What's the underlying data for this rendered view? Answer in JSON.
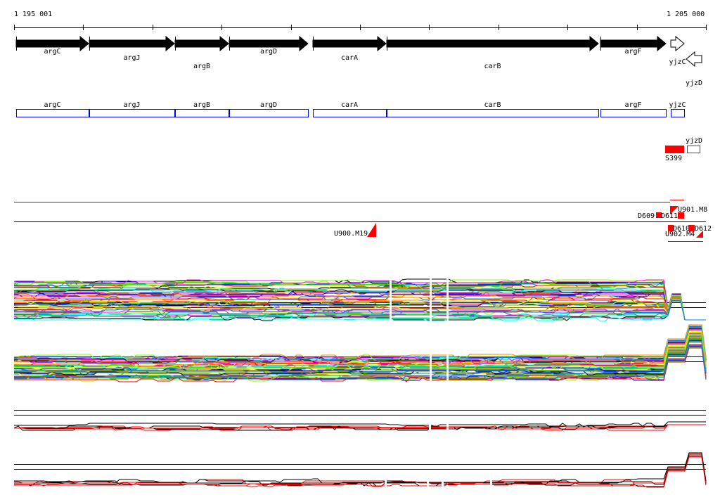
{
  "ruler": {
    "start_label": "1 195 001",
    "end_label": "1 205 000",
    "start": 1195001,
    "end": 1205000
  },
  "genes": [
    {
      "name": "argC",
      "start": 1195031,
      "end": 1196080,
      "strand": "+"
    },
    {
      "name": "argJ",
      "start": 1196091,
      "end": 1197320,
      "strand": "+"
    },
    {
      "name": "argB",
      "start": 1197331,
      "end": 1198100,
      "strand": "+"
    },
    {
      "name": "argD",
      "start": 1198111,
      "end": 1199250,
      "strand": "+"
    },
    {
      "name": "carA",
      "start": 1199321,
      "end": 1200380,
      "strand": "+"
    },
    {
      "name": "carB",
      "start": 1200391,
      "end": 1203450,
      "strand": "+"
    },
    {
      "name": "argF",
      "start": 1203471,
      "end": 1204420,
      "strand": "+"
    },
    {
      "name": "yjzC",
      "start": 1204490,
      "end": 1204690,
      "strand": "+"
    },
    {
      "name": "yjzD",
      "start": 1204720,
      "end": 1204940,
      "strand": "-"
    }
  ],
  "features": {
    "S399": {
      "label": "S399"
    },
    "upshift_labels": [
      "U900.M19",
      "U901.M8",
      "U902.M4"
    ],
    "downshift_labels": [
      "D609",
      "D611",
      "D610",
      "D612"
    ]
  },
  "track_colors": [
    "#000000",
    "#ff0000",
    "#00c000",
    "#0000ff",
    "#ff00ff",
    "#00ffff",
    "#ffff00",
    "#ff8000",
    "#808080",
    "#a05050",
    "#80ff00",
    "#0080ff"
  ]
}
